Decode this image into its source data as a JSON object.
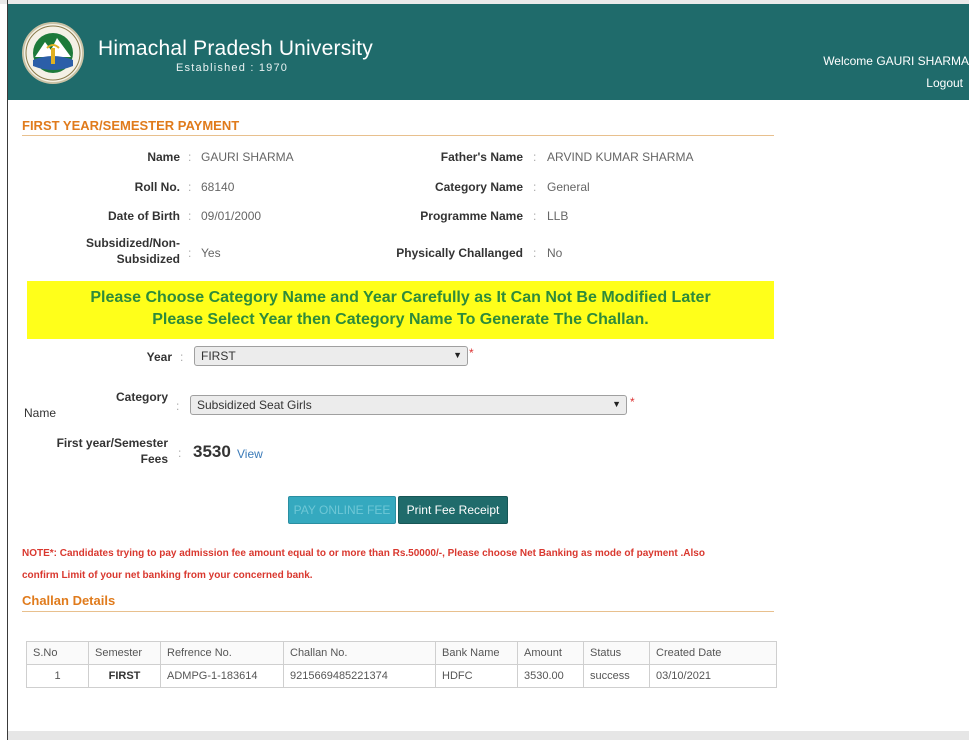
{
  "header": {
    "title": "Himachal Pradesh University",
    "established": "Established : 1970",
    "welcome": "Welcome GAURI SHARMA",
    "logout": "Logout"
  },
  "section": {
    "title": "FIRST YEAR/SEMESTER PAYMENT"
  },
  "student": {
    "name_label": "Name",
    "name": "GAURI SHARMA",
    "father_label": "Father's Name",
    "father": "ARVIND KUMAR SHARMA",
    "roll_label": "Roll No.",
    "roll": "68140",
    "category_label": "Category Name",
    "category": "General",
    "dob_label": "Date of Birth",
    "dob": "09/01/2000",
    "programme_label": "Programme Name",
    "programme": "LLB",
    "subsidized_label_1": "Subsidized/Non-",
    "subsidized_label_2": "Subsidized",
    "subsidized": "Yes",
    "physically_label": "Physically Challanged",
    "physically": "No"
  },
  "banner": {
    "line1": "Please Choose Category Name and Year Carefully as It Can Not Be Modified Later",
    "line2": "Please Select Year then Category Name To Generate The Challan."
  },
  "form": {
    "year_label": "Year",
    "year_value": "FIRST",
    "category_label_1": "Category",
    "category_label_2": "Name",
    "category_value": "Subsidized Seat Girls",
    "fee_label_1": "First year/Semester",
    "fee_label_2": "Fees",
    "fee_value": "3530",
    "fee_link": "View",
    "required": "*"
  },
  "buttons": {
    "pay": "PAY ONLINE FEE",
    "print": "Print Fee Receipt"
  },
  "note": {
    "line1": "NOTE*: Candidates trying to pay admission fee amount equal to or more than Rs.50000/-, Please choose Net Banking as mode of payment .Also",
    "line2": "confirm Limit of your net banking from your concerned bank."
  },
  "challan": {
    "title": "Challan Details",
    "columns": [
      "S.No",
      "Semester",
      "Refrence No.",
      "Challan No.",
      "Bank Name",
      "Amount",
      "Status",
      "Created Date"
    ],
    "rows": [
      [
        "1",
        "FIRST",
        "ADMPG-1-183614",
        "9215669485221374",
        "HDFC",
        "3530.00",
        "success",
        "03/10/2021"
      ]
    ]
  },
  "colors": {
    "header_bg": "#1f6b6b",
    "accent_orange": "#e07b1c",
    "banner_yellow": "#ffff1a",
    "banner_green": "#2e8b3a",
    "note_red": "#d9382f"
  }
}
